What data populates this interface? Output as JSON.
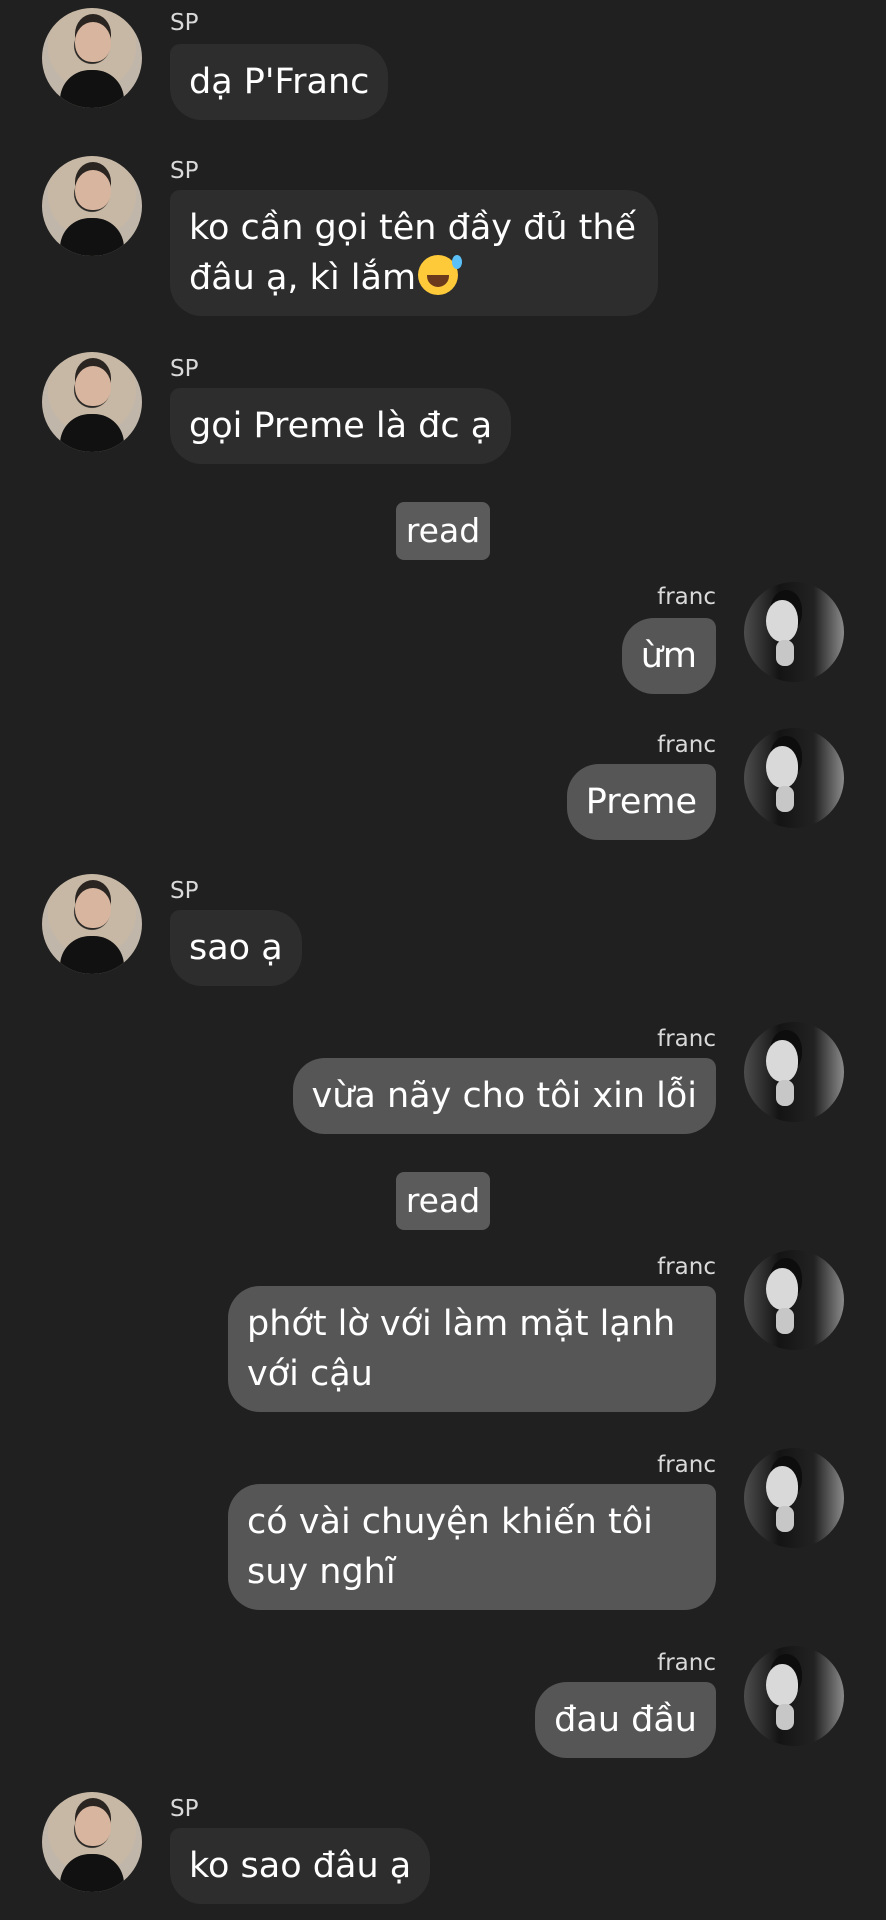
{
  "participants": {
    "other": "SP",
    "me": "franc"
  },
  "messages": [
    {
      "sender": "SP",
      "text": "dạ P'Franc"
    },
    {
      "sender": "SP",
      "text_line1": "ko cần gọi tên đầy đủ thế",
      "text_line2": "đâu ạ, kì lắm",
      "emoji": "sweat-smile-emoji"
    },
    {
      "sender": "SP",
      "text": "gọi Preme là đc ạ"
    },
    {
      "sender": "franc",
      "text": "ừm"
    },
    {
      "sender": "franc",
      "text": "Preme"
    },
    {
      "sender": "SP",
      "text": "sao ạ"
    },
    {
      "sender": "franc",
      "text": "vừa nãy cho tôi xin lỗi"
    },
    {
      "sender": "franc",
      "text_line1": "phớt lờ với làm mặt lạnh",
      "text_line2": "với cậu"
    },
    {
      "sender": "franc",
      "text_line1": "có vài chuyện khiến tôi",
      "text_line2": "suy nghĩ"
    },
    {
      "sender": "franc",
      "text": "đau đầu"
    },
    {
      "sender": "SP",
      "text": "ko sao đâu ạ"
    }
  ],
  "read_receipts": [
    "read",
    "read"
  ],
  "colors": {
    "background": "#202020",
    "incoming_bubble": "#2d2d2d",
    "outgoing_bubble": "#565656",
    "read_badge": "#5b5b5b"
  }
}
